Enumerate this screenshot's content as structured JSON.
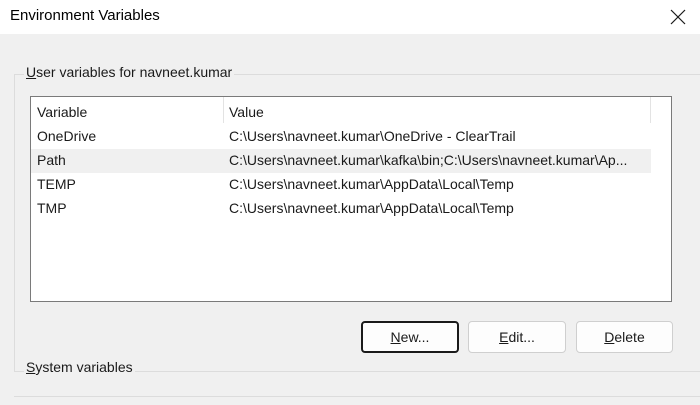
{
  "window": {
    "title": "Environment Variables"
  },
  "user_group": {
    "label_mnemonic": "U",
    "label_rest": "ser variables for navneet.kumar",
    "columns": [
      "Variable",
      "Value"
    ],
    "rows": [
      {
        "name": "OneDrive",
        "value": "C:\\Users\\navneet.kumar\\OneDrive - ClearTrail"
      },
      {
        "name": "Path",
        "value": "C:\\Users\\navneet.kumar\\kafka\\bin;C:\\Users\\navneet.kumar\\Ap..."
      },
      {
        "name": "TEMP",
        "value": "C:\\Users\\navneet.kumar\\AppData\\Local\\Temp"
      },
      {
        "name": "TMP",
        "value": "C:\\Users\\navneet.kumar\\AppData\\Local\\Temp"
      }
    ],
    "selected_row": "Path"
  },
  "buttons": {
    "new": {
      "mnemonic": "N",
      "rest": "ew..."
    },
    "edit": {
      "mnemonic": "E",
      "rest": "dit..."
    },
    "delete": {
      "mnemonic": "D",
      "rest": "elete"
    }
  },
  "system_group": {
    "label_mnemonic": "S",
    "label_rest": "ystem variables"
  },
  "colors": {
    "background": "#f0f0f0",
    "titlebar": "#ffffff",
    "list_background": "#ffffff",
    "selected_row": "#f0f0f0",
    "primary_button_border": "#1a1a1a"
  },
  "icons": {
    "close": "close-icon"
  }
}
